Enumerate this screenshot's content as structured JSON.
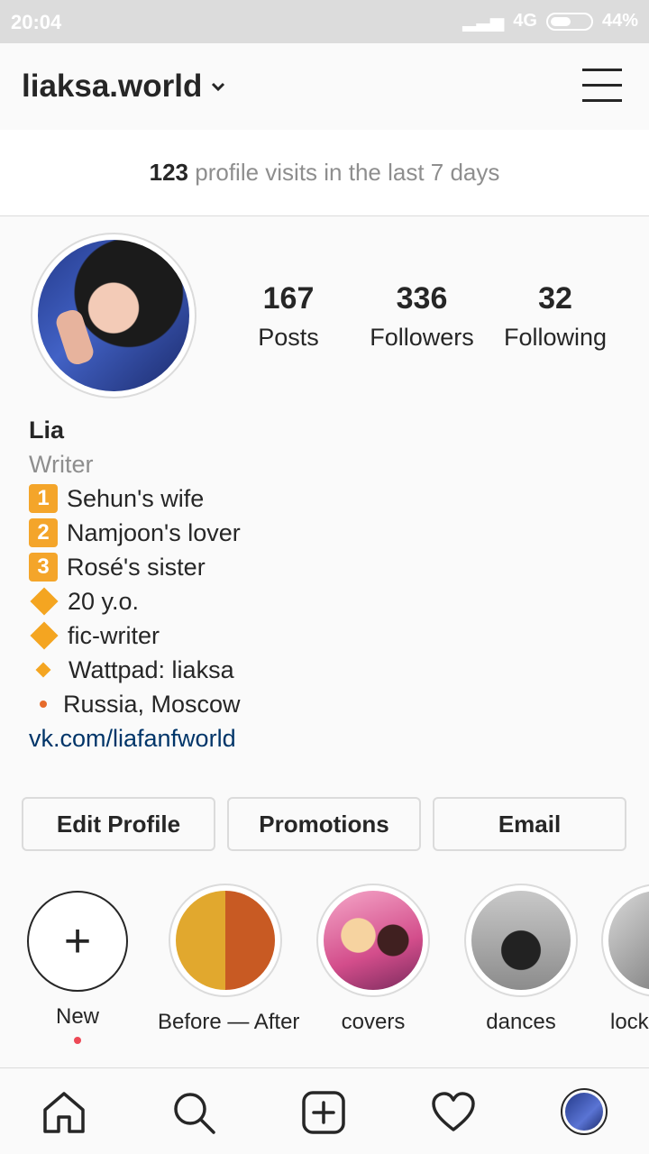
{
  "status_bar": {
    "time": "20:04",
    "network": "4G",
    "battery": "44%"
  },
  "header": {
    "username": "liaksa.world"
  },
  "visits": {
    "count": "123",
    "text": "profile visits in the last 7 days"
  },
  "stats": [
    {
      "value": "167",
      "label": "Posts"
    },
    {
      "value": "336",
      "label": "Followers"
    },
    {
      "value": "32",
      "label": "Following"
    }
  ],
  "bio": {
    "name": "Lia",
    "category": "Writer",
    "lines": [
      {
        "marker": "1",
        "text": "Sehun's wife"
      },
      {
        "marker": "2",
        "text": "Namjoon's lover"
      },
      {
        "marker": "3",
        "text": "Rosé's sister"
      },
      {
        "marker": "diamond",
        "text": "20 y.o."
      },
      {
        "marker": "diamond",
        "text": "fic-writer"
      },
      {
        "marker": "small-diamond",
        "text": "Wattpad: liaksa"
      },
      {
        "marker": "dot",
        "text": "Russia, Moscow"
      }
    ],
    "link": "vk.com/liafanfworld"
  },
  "buttons": {
    "edit": "Edit Profile",
    "promotions": "Promotions",
    "email": "Email"
  },
  "highlights": [
    {
      "label": "New"
    },
    {
      "label": "Before — After"
    },
    {
      "label": "covers"
    },
    {
      "label": "dances"
    },
    {
      "label": "lock"
    }
  ],
  "colors": {
    "link": "#003569",
    "badge": "#f4a52a",
    "notification_dot": "#ed4956"
  }
}
